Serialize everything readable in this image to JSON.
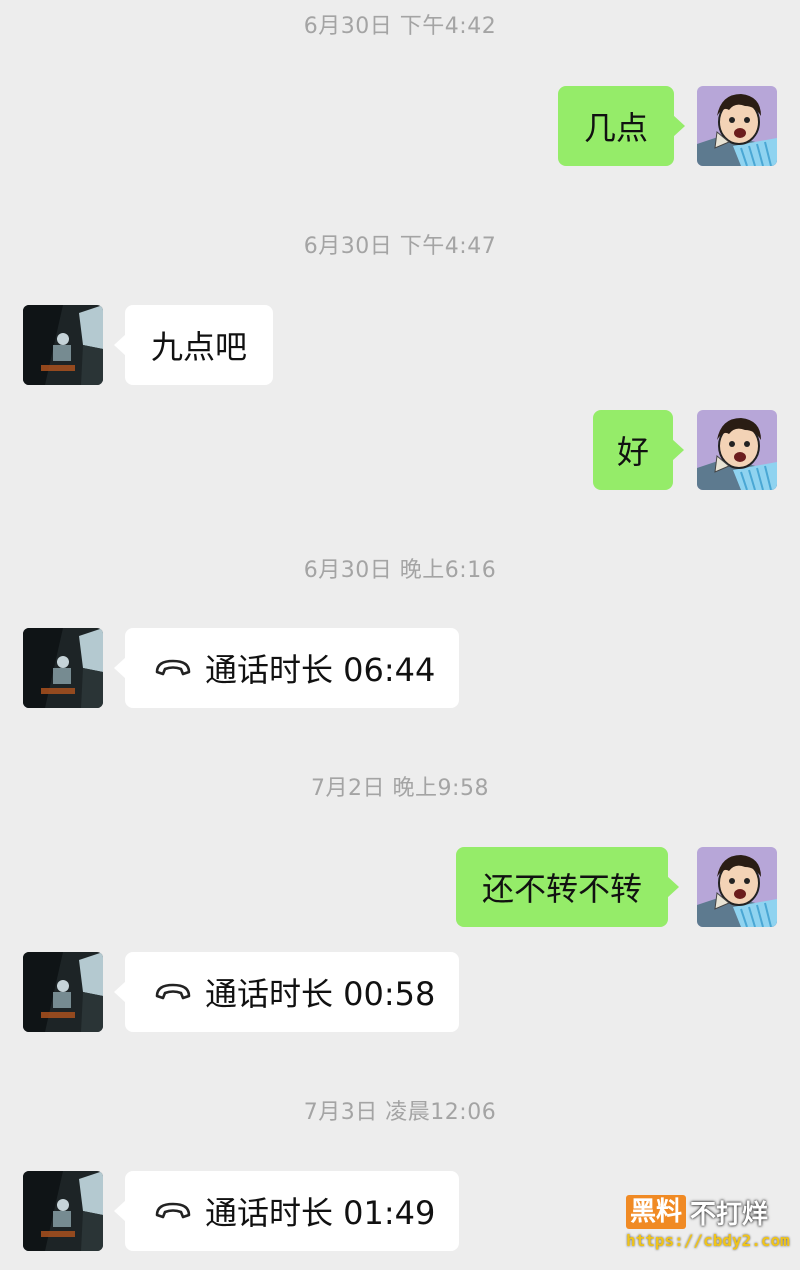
{
  "timestamps": [
    "6月30日 下午4:42",
    "6月30日 下午4:47",
    "6月30日 晚上6:16",
    "7月2日 晚上9:58",
    "7月3日 凌晨12:06"
  ],
  "messages": [
    {
      "dir": "out",
      "text": "几点"
    },
    {
      "dir": "in",
      "text": "九点吧"
    },
    {
      "dir": "out",
      "text": "好"
    },
    {
      "dir": "in",
      "type": "call",
      "text": "通话时长 06:44"
    },
    {
      "dir": "out",
      "text": "还不转不转"
    },
    {
      "dir": "in",
      "type": "call",
      "text": "通话时长 00:58"
    },
    {
      "dir": "in",
      "type": "call",
      "text": "通话时长 01:49"
    }
  ],
  "watermark": {
    "badge": "黑料",
    "rest": "不打烊",
    "url": "https://cbdy2.com"
  },
  "colors": {
    "background": "#ededed",
    "outgoing_bubble": "#95ec69",
    "incoming_bubble": "#ffffff",
    "timestamp_text": "#a4a4a4"
  },
  "icons": {
    "call": "phone-hangup-icon",
    "self_avatar": "cartoon-person-avatar-icon",
    "contact_avatar": "dark-scene-avatar-icon"
  }
}
